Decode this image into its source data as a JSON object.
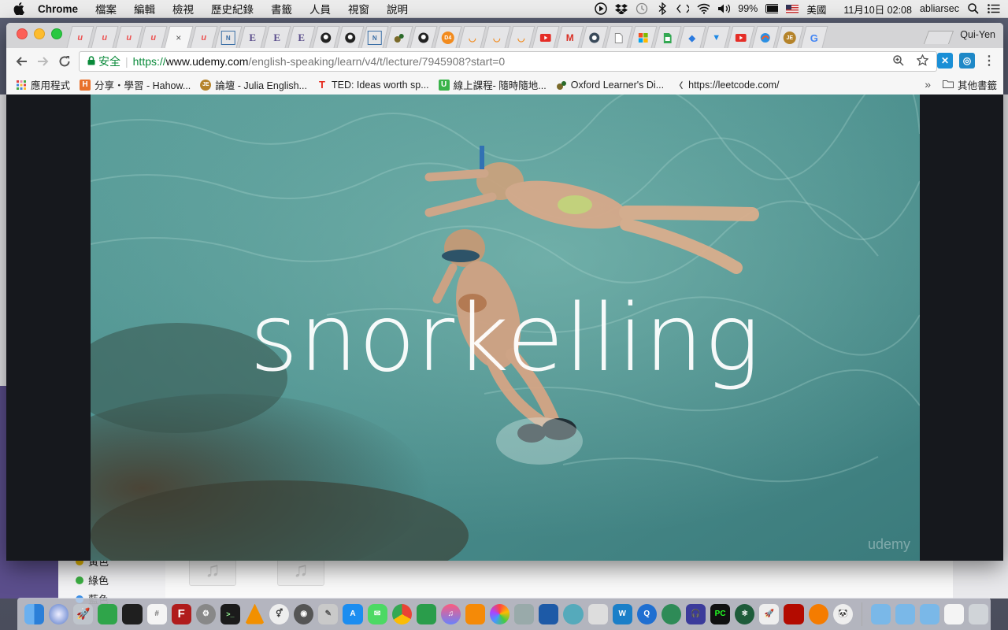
{
  "menubar": {
    "apple_icon": "apple-icon",
    "app_name": "Chrome",
    "menus": [
      "檔案",
      "編輯",
      "檢視",
      "歷史紀錄",
      "書籤",
      "人員",
      "視窗",
      "說明"
    ],
    "battery": "99%",
    "input_source": "美國",
    "clock": "11月10日  02:08",
    "user": "abliarsec"
  },
  "browser": {
    "profile_name": "Qui-Yen",
    "url_secure_label": "安全",
    "url_scheme": "https://",
    "url_host": "www.udemy.com",
    "url_path": "/english-speaking/learn/v4/t/lecture/7945908?start=0",
    "active_tab_close": "×",
    "bookmarks": [
      {
        "label": "應用程式"
      },
      {
        "label": "分享・學習 - Hahow..."
      },
      {
        "label": "論壇 - Julia English..."
      },
      {
        "label": "TED: Ideas worth sp..."
      },
      {
        "label": "線上課程- 隨時隨地..."
      },
      {
        "label": "Oxford Learner's Di..."
      },
      {
        "label": "https://leetcode.com/"
      }
    ],
    "other_bookmarks": "其他書籤",
    "more_bookmarks": "»"
  },
  "video": {
    "caption": "snorkelling",
    "watermark": "udemy"
  },
  "background_window": {
    "tags": [
      "黃色",
      "綠色",
      "藍色"
    ]
  },
  "colors": {
    "udemy_red": "#ec5252",
    "secure_green": "#0a8a3a",
    "water_1": "#5a9c98",
    "water_2": "#3f7f80"
  }
}
